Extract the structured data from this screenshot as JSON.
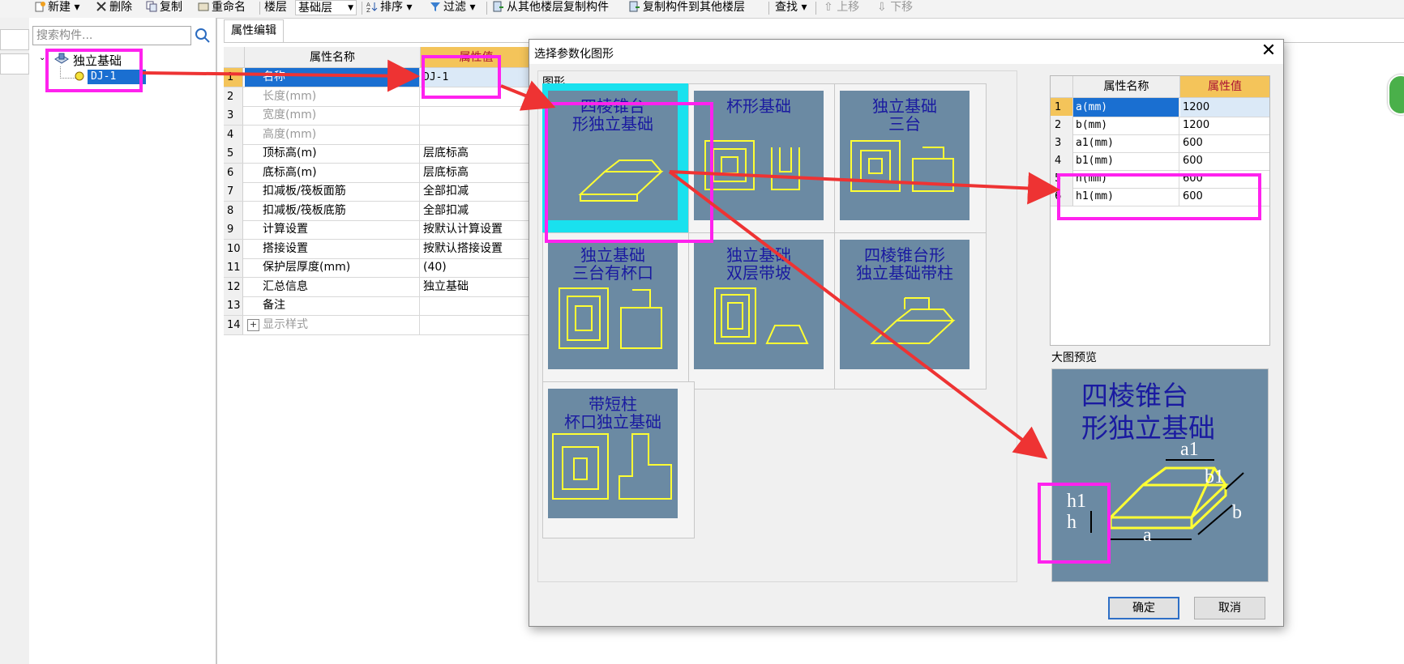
{
  "toolbar": {
    "new": "新建",
    "delete": "删除",
    "copy": "复制",
    "rename": "重命名",
    "floor_label": "楼层",
    "floor_value": "基础层",
    "sort": "排序",
    "filter": "过滤",
    "copy_from_floor": "从其他楼层复制构件",
    "copy_to_floor": "复制构件到其他楼层",
    "find": "查找",
    "move_up": "上移",
    "move_down": "下移"
  },
  "tree": {
    "search_placeholder": "搜索构件...",
    "root": "独立基础",
    "child": "DJ-1"
  },
  "property_panel": {
    "tab": "属性编辑",
    "header_name": "属性名称",
    "header_value": "属性值",
    "rows": [
      {
        "no": "1",
        "name": "名称",
        "value": "DJ-1"
      },
      {
        "no": "2",
        "name": "长度(mm)",
        "value": ""
      },
      {
        "no": "3",
        "name": "宽度(mm)",
        "value": ""
      },
      {
        "no": "4",
        "name": "高度(mm)",
        "value": ""
      },
      {
        "no": "5",
        "name": "顶标高(m)",
        "value": "层底标高"
      },
      {
        "no": "6",
        "name": "底标高(m)",
        "value": "层底标高"
      },
      {
        "no": "7",
        "name": "扣减板/筏板面筋",
        "value": "全部扣减"
      },
      {
        "no": "8",
        "name": "扣减板/筏板底筋",
        "value": "全部扣减"
      },
      {
        "no": "9",
        "name": "计算设置",
        "value": "按默认计算设置"
      },
      {
        "no": "10",
        "name": "搭接设置",
        "value": "按默认搭接设置"
      },
      {
        "no": "11",
        "name": "保护层厚度(mm)",
        "value": "(40)"
      },
      {
        "no": "12",
        "name": "汇总信息",
        "value": "独立基础"
      },
      {
        "no": "13",
        "name": "备注",
        "value": ""
      },
      {
        "no": "14",
        "name": "显示样式",
        "value": ""
      }
    ]
  },
  "dialog": {
    "title": "选择参数化图形",
    "shapes_label": "图形",
    "shapes": [
      {
        "l1": "四棱锥台",
        "l2": "形独立基础"
      },
      {
        "l1": "杯形基础",
        "l2": ""
      },
      {
        "l1": "独立基础",
        "l2": "三台"
      },
      {
        "l1": "独立基础",
        "l2": "三台有杯口"
      },
      {
        "l1": "独立基础",
        "l2": "双层带坡"
      },
      {
        "l1": "四棱锥台形",
        "l2": "独立基础带柱"
      },
      {
        "l1": "带短柱",
        "l2": "杯口独立基础"
      }
    ],
    "param_header_name": "属性名称",
    "param_header_value": "属性值",
    "params": [
      {
        "no": "1",
        "name": "a(mm)",
        "value": "1200"
      },
      {
        "no": "2",
        "name": "b(mm)",
        "value": "1200"
      },
      {
        "no": "3",
        "name": "a1(mm)",
        "value": "600"
      },
      {
        "no": "4",
        "name": "b1(mm)",
        "value": "600"
      },
      {
        "no": "5",
        "name": "h(mm)",
        "value": "600"
      },
      {
        "no": "6",
        "name": "h1(mm)",
        "value": "600"
      }
    ],
    "preview_label": "大图预览",
    "preview_title_1": "四棱锥台",
    "preview_title_2": "形独立基础",
    "dim_labels": {
      "a1": "a1",
      "b1": "b1",
      "h1": "h1",
      "h": "h",
      "a": "a",
      "b": "b"
    },
    "ok": "确定",
    "cancel": "取消"
  },
  "colors": {
    "highlight": "#ff22ee",
    "arrow": "#ee3333",
    "selection_blue": "#1a6fd1",
    "thumb_bg": "#6b8aa3",
    "thumb_selected": "#19e1ee",
    "diagram_yellow": "#ffff33",
    "diagram_title": "#1a1aa0",
    "value_header": "#f4c45a"
  }
}
